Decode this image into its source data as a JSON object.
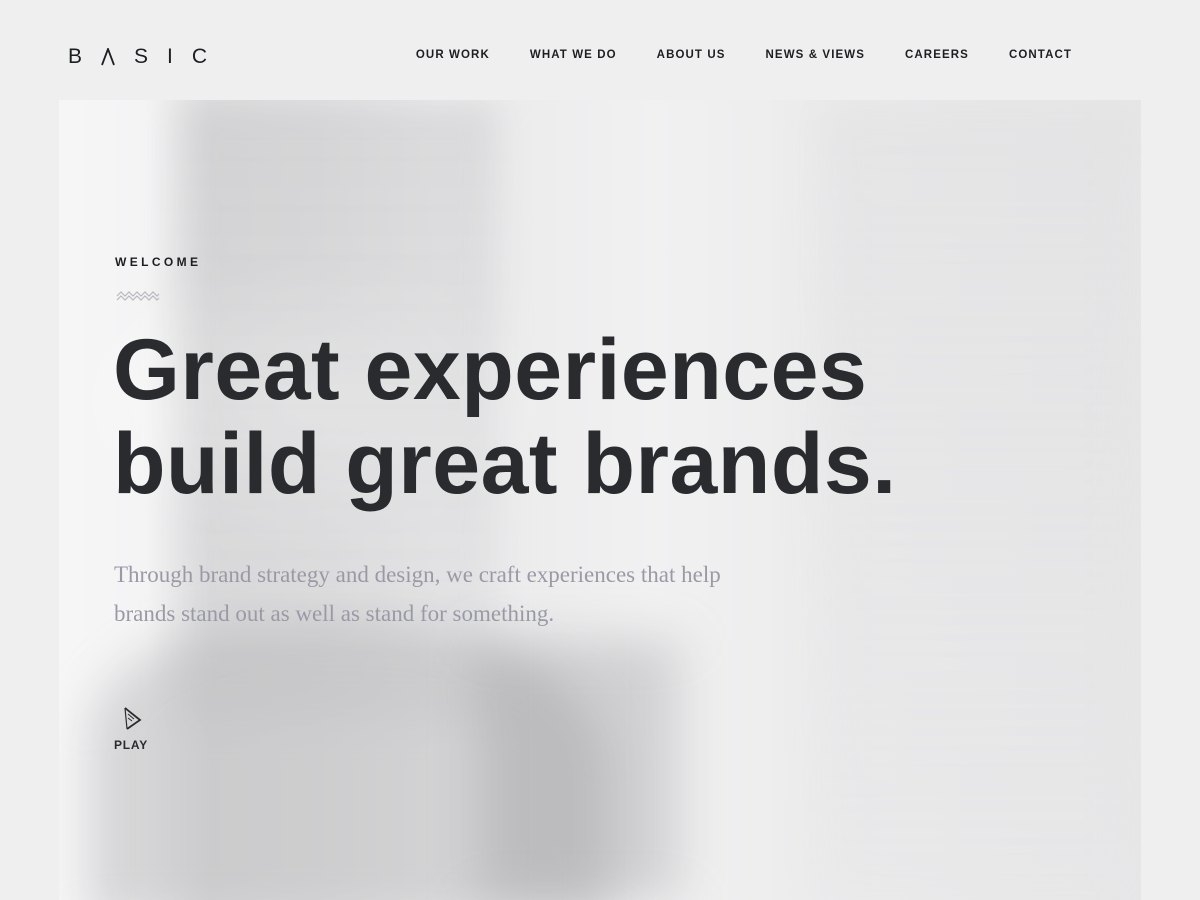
{
  "header": {
    "logo_letters": [
      "B",
      "S",
      "I",
      "C"
    ],
    "nav": [
      {
        "label": "OUR WORK"
      },
      {
        "label": "WHAT WE DO"
      },
      {
        "label": "ABOUT US"
      },
      {
        "label": "NEWS & VIEWS"
      },
      {
        "label": "CAREERS"
      },
      {
        "label": "CONTACT"
      }
    ]
  },
  "hero": {
    "eyebrow": "WELCOME",
    "headline_line1": "Great experiences",
    "headline_line2": "build great brands.",
    "lead_line1": "Through brand strategy and design, we craft experiences that help",
    "lead_line2": "brands stand out as well as stand for something.",
    "play_label": "PLAY"
  },
  "colors": {
    "background": "#efefef",
    "text_dark": "#2a2b2f",
    "text_muted": "#9a9aa6"
  },
  "icons": {
    "logo_a": "caret-a-icon",
    "squiggle": "squiggle-icon",
    "play": "play-icon"
  }
}
